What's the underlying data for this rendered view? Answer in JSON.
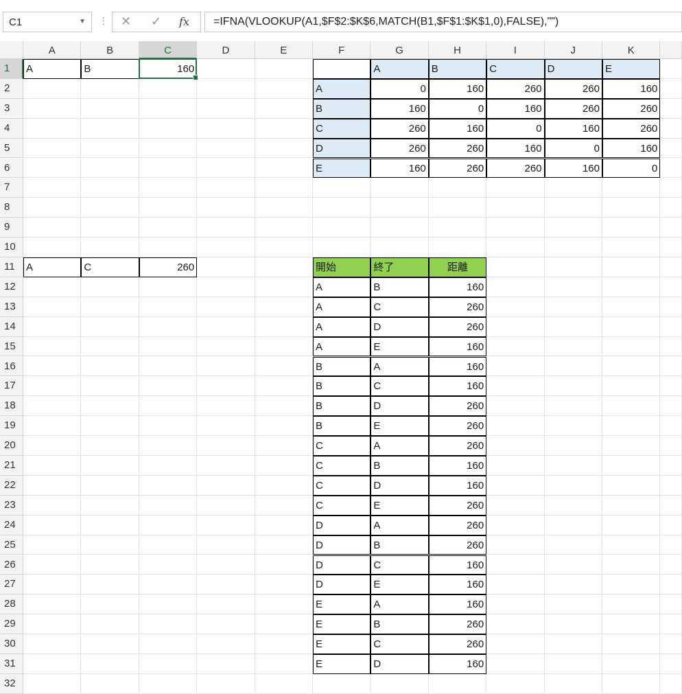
{
  "namebox": {
    "value": "C1"
  },
  "formula": {
    "text": "=IFNA(VLOOKUP(A1,$F$2:$K$6,MATCH(B1,$F$1:$K$1,0),FALSE),\"\")"
  },
  "columns": [
    "A",
    "B",
    "C",
    "D",
    "E",
    "F",
    "G",
    "H",
    "I",
    "J",
    "K"
  ],
  "rows": [
    "1",
    "2",
    "3",
    "4",
    "5",
    "6",
    "7",
    "8",
    "9",
    "10",
    "11",
    "12",
    "13",
    "14",
    "15",
    "16",
    "17",
    "18",
    "19",
    "20",
    "21",
    "22",
    "23",
    "24",
    "25",
    "26",
    "27",
    "28",
    "29",
    "30",
    "31",
    "32"
  ],
  "selected_cell": "C1",
  "lookup1": {
    "from": "A",
    "to": "B",
    "distance": "160"
  },
  "lookup2": {
    "from": "A",
    "to": "C",
    "distance": "260"
  },
  "matrix": {
    "headers": [
      "A",
      "B",
      "C",
      "D",
      "E"
    ],
    "rows": [
      {
        "label": "A",
        "values": [
          "0",
          "160",
          "260",
          "260",
          "160"
        ]
      },
      {
        "label": "B",
        "values": [
          "160",
          "0",
          "160",
          "260",
          "260"
        ]
      },
      {
        "label": "C",
        "values": [
          "260",
          "160",
          "0",
          "160",
          "260"
        ]
      },
      {
        "label": "D",
        "values": [
          "260",
          "260",
          "160",
          "0",
          "160"
        ]
      },
      {
        "label": "E",
        "values": [
          "160",
          "260",
          "260",
          "160",
          "0"
        ]
      }
    ]
  },
  "pairs": {
    "headers": [
      "開始",
      "終了",
      "距離"
    ],
    "rows": [
      [
        "A",
        "B",
        "160"
      ],
      [
        "A",
        "C",
        "260"
      ],
      [
        "A",
        "D",
        "260"
      ],
      [
        "A",
        "E",
        "160"
      ],
      [
        "B",
        "A",
        "160"
      ],
      [
        "B",
        "C",
        "160"
      ],
      [
        "B",
        "D",
        "260"
      ],
      [
        "B",
        "E",
        "260"
      ],
      [
        "C",
        "A",
        "260"
      ],
      [
        "C",
        "B",
        "160"
      ],
      [
        "C",
        "D",
        "160"
      ],
      [
        "C",
        "E",
        "260"
      ],
      [
        "D",
        "A",
        "260"
      ],
      [
        "D",
        "B",
        "260"
      ],
      [
        "D",
        "C",
        "160"
      ],
      [
        "D",
        "E",
        "160"
      ],
      [
        "E",
        "A",
        "160"
      ],
      [
        "E",
        "B",
        "260"
      ],
      [
        "E",
        "C",
        "260"
      ],
      [
        "E",
        "D",
        "160"
      ]
    ]
  },
  "colors": {
    "header_blue": "#ddebf7",
    "header_green": "#92d050",
    "selection": "#217346"
  }
}
